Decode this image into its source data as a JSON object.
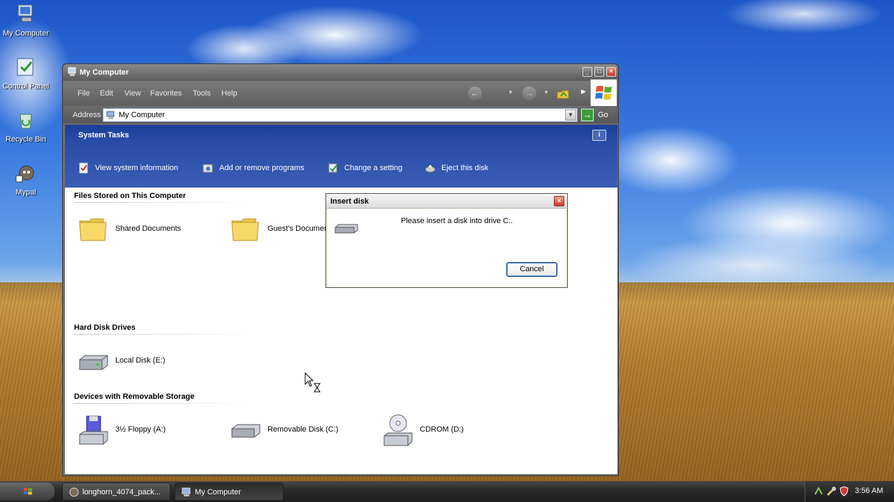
{
  "desktop": {
    "icons": [
      {
        "label": "My Computer"
      },
      {
        "label": "Control Panel"
      },
      {
        "label": "Recycle Bin"
      },
      {
        "label": "Mypal"
      }
    ]
  },
  "window": {
    "title": "My Computer",
    "menu": [
      "File",
      "Edit",
      "View",
      "Favorites",
      "Tools",
      "Help"
    ],
    "address": {
      "label": "Address",
      "value": "My Computer",
      "go_label": "Go"
    },
    "system_tasks": {
      "title": "System Tasks",
      "items": [
        {
          "label": "View system information",
          "icon": "system-info-icon"
        },
        {
          "label": "Add or remove programs",
          "icon": "add-remove-icon"
        },
        {
          "label": "Change a setting",
          "icon": "control-panel-icon"
        },
        {
          "label": "Eject this disk",
          "icon": "eject-icon"
        }
      ]
    },
    "groups": {
      "files": {
        "title": "Files Stored on This Computer",
        "items": [
          {
            "label": "Shared Documents",
            "icon": "folder-icon"
          },
          {
            "label": "Guest's Documents",
            "icon": "folder-icon"
          }
        ]
      },
      "hard_disks": {
        "title": "Hard Disk Drives",
        "items": [
          {
            "label": "Local Disk (E:)",
            "icon": "hard-disk-icon"
          }
        ]
      },
      "removable": {
        "title": "Devices with Removable Storage",
        "items": [
          {
            "label": "3½ Floppy (A:)",
            "icon": "floppy-drive-icon"
          },
          {
            "label": "Removable Disk (C:)",
            "icon": "removable-disk-icon"
          },
          {
            "label": "CDROM (D:)",
            "icon": "cdrom-icon"
          }
        ]
      }
    }
  },
  "dialog": {
    "title": "Insert disk",
    "message": "Please insert a disk into drive C:.",
    "cancel_label": "Cancel"
  },
  "taskbar": {
    "buttons": [
      {
        "label": "longhorn_4074_pack...",
        "active": false
      },
      {
        "label": "My Computer",
        "active": true
      }
    ],
    "clock": "3:56 AM"
  },
  "colors": {
    "tasks_band": "#2a4ea8",
    "window_chrome": "#6e6e6e",
    "dialog_face": "#ece9d8"
  }
}
